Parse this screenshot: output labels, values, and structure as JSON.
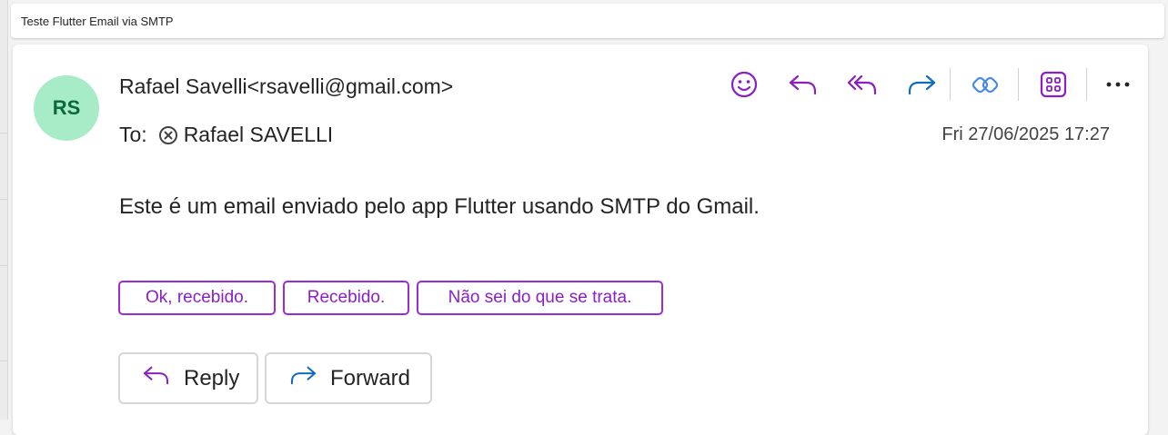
{
  "email": {
    "subject": "Teste Flutter Email via SMTP",
    "avatar_initials": "RS",
    "sender": "Rafael Savelli<rsavelli@gmail.com>",
    "to_label": "To:",
    "recipient": "Rafael SAVELLI",
    "date": "Fri 27/06/2025 17:27",
    "body": "Este é um email enviado pelo app Flutter usando SMTP do Gmail."
  },
  "toolbar": {
    "icons": [
      "smiley-icon",
      "reply-icon",
      "reply-all-icon",
      "forward-icon",
      "viva-insights-icon",
      "apps-icon",
      "more-icon"
    ]
  },
  "quick_replies": [
    "Ok, recebido.",
    "Recebido.",
    "Não sei do que se trata."
  ],
  "actions": {
    "reply_label": "Reply",
    "forward_label": "Forward"
  },
  "colors": {
    "accent_purple": "#8a1fc4",
    "forward_blue": "#0f6cbd",
    "avatar_bg": "#a7ebc7",
    "avatar_text": "#0b6a3b"
  }
}
